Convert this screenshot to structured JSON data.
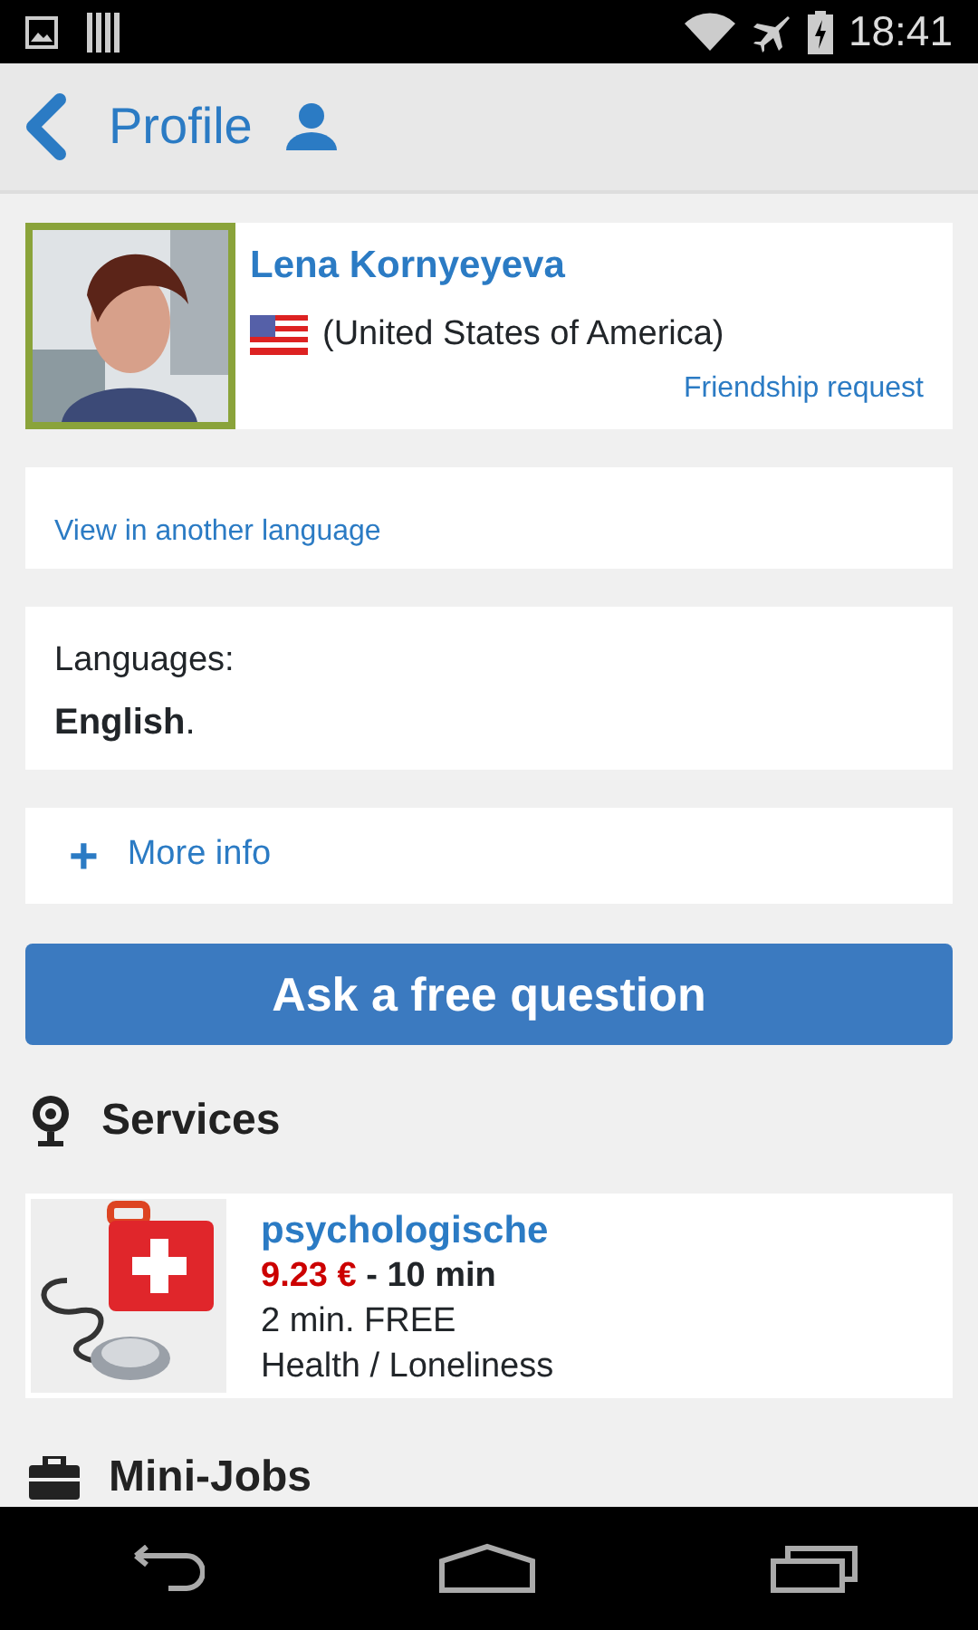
{
  "status_bar": {
    "time": "18:41"
  },
  "header": {
    "title": "Profile"
  },
  "profile": {
    "name": "Lena Kornyeyeva",
    "country": "(United States of America)",
    "friend_link": "Friendship request"
  },
  "view_language_link": "View in another language",
  "languages": {
    "label": "Languages:",
    "value": "**English**."
  },
  "more_info": {
    "plus": "+",
    "label": "More info"
  },
  "ask_button": "Ask a free question",
  "services": {
    "title": "Services",
    "items": [
      {
        "name": "psychologische",
        "price": "9.23 €",
        "duration": " - 10 min",
        "free": "2 min. FREE",
        "category": "Health / Loneliness"
      }
    ]
  },
  "minijobs": {
    "title": "Mini-Jobs"
  }
}
